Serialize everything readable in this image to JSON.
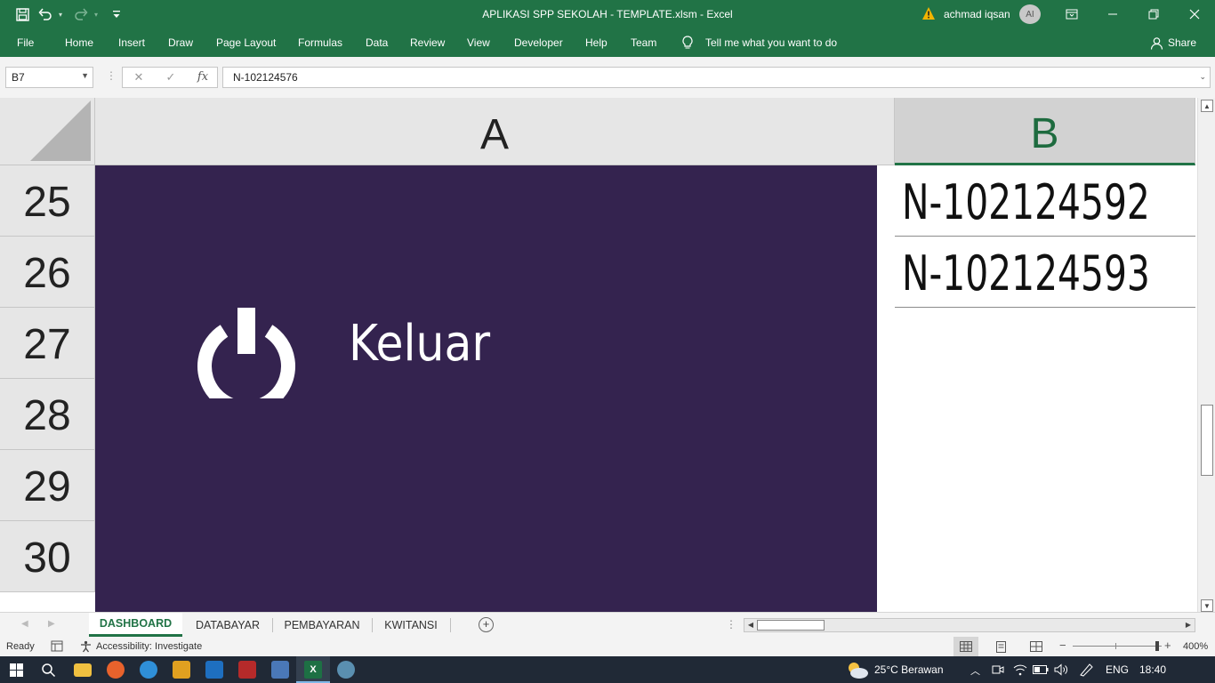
{
  "window": {
    "title": "APLIKASI SPP SEKOLAH - TEMPLATE.xlsm  -  Excel",
    "user_name": "achmad iqsan",
    "user_initials": "AI"
  },
  "ribbon": {
    "tabs": [
      "File",
      "Home",
      "Insert",
      "Draw",
      "Page Layout",
      "Formulas",
      "Data",
      "Review",
      "View",
      "Developer",
      "Help",
      "Team"
    ],
    "tell_me": "Tell me what you want to do",
    "share": "Share"
  },
  "formula_bar": {
    "name_box": "B7",
    "fx_label": "fx",
    "value": "N-102124576"
  },
  "sheet": {
    "columns": [
      "A",
      "B"
    ],
    "rows": [
      "25",
      "26",
      "27",
      "28",
      "29",
      "30"
    ],
    "button_label": "Keluar",
    "cells_b": [
      "N-102124592",
      "N-102124593"
    ]
  },
  "sheet_tabs": [
    "DASHBOARD",
    "DATABAYAR",
    "PEMBAYARAN",
    "KWITANSI"
  ],
  "status": {
    "ready": "Ready",
    "accessibility": "Accessibility: Investigate",
    "zoom": "400%"
  },
  "taskbar": {
    "weather": "25°C  Berawan",
    "lang": "ENG",
    "time": "18:40"
  },
  "colors": {
    "excel_green": "#217346",
    "panel_purple": "#34234f"
  }
}
